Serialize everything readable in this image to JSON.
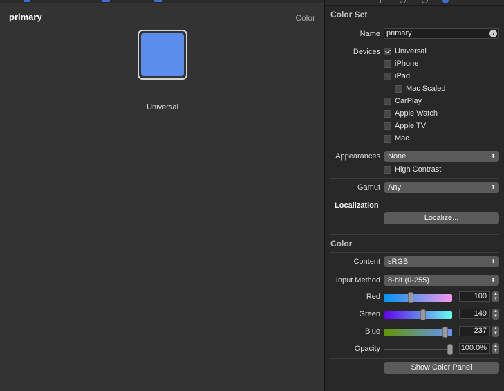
{
  "editor": {
    "asset_name": "primary",
    "asset_kind": "Color",
    "swatch_label": "Universal",
    "swatch_color": "#5B8DEE"
  },
  "inspector": {
    "color_set": {
      "header": "Color Set",
      "name_label": "Name",
      "name_value": "primary",
      "devices_label": "Devices",
      "devices": [
        {
          "label": "Universal",
          "checked": true
        },
        {
          "label": "iPhone",
          "checked": false
        },
        {
          "label": "iPad",
          "checked": false
        },
        {
          "label": "Mac Scaled",
          "checked": false
        },
        {
          "label": "CarPlay",
          "checked": false
        },
        {
          "label": "Apple Watch",
          "checked": false
        },
        {
          "label": "Apple TV",
          "checked": false
        },
        {
          "label": "Mac",
          "checked": false
        }
      ],
      "appearances_label": "Appearances",
      "appearances_value": "None",
      "high_contrast_label": "High Contrast",
      "gamut_label": "Gamut",
      "gamut_value": "Any"
    },
    "localization": {
      "header": "Localization",
      "button_label": "Localize..."
    },
    "color": {
      "header": "Color",
      "content_label": "Content",
      "content_value": "sRGB",
      "input_method_label": "Input Method",
      "input_method_value": "8-bit (0-255)",
      "red_label": "Red",
      "red_value": "100",
      "green_label": "Green",
      "green_value": "149",
      "blue_label": "Blue",
      "blue_value": "237",
      "opacity_label": "Opacity",
      "opacity_value": "100.0%",
      "show_panel_label": "Show Color Panel"
    }
  },
  "colors": {
    "accent": "#3B6FD6",
    "swatch": "#5B8DEE"
  }
}
